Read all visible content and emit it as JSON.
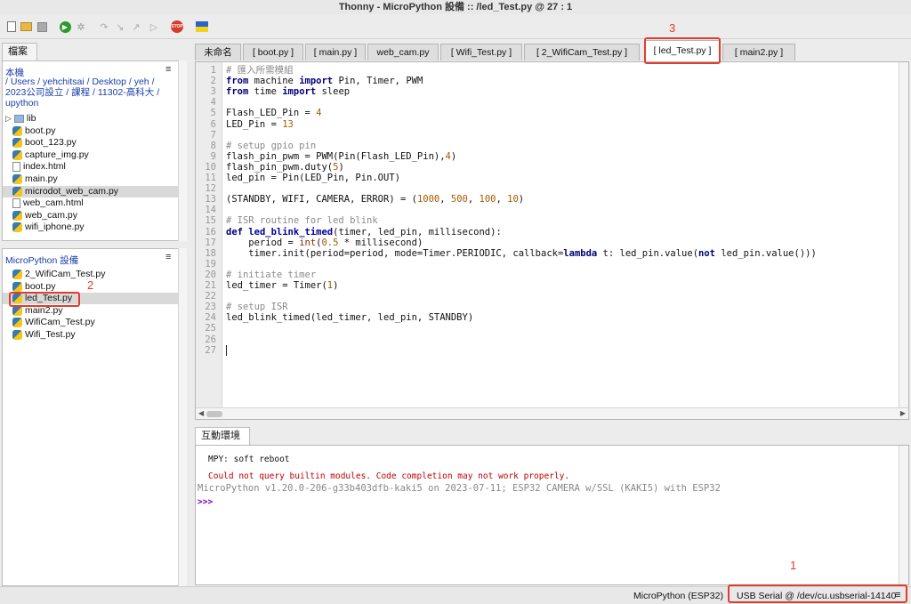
{
  "window": {
    "title": "Thonny  -  MicroPython 設備 :: /led_Test.py  @  27 : 1"
  },
  "toolbar": {
    "items": [
      "new-file-icon",
      "open-file-icon",
      "save-icon",
      "run-icon",
      "debug-icon",
      "step-over-icon",
      "step-into-icon",
      "step-out-icon",
      "resume-icon",
      "stop-icon",
      "flag-icon"
    ],
    "stop_label": "STOP"
  },
  "files_panel": {
    "tab": "檔案",
    "local": {
      "heading": "本機",
      "path_lines": [
        "/ Users / yehchitsai / Desktop / yeh /",
        "2023公司設立 / 課程 / 11302-高科大 /",
        "upython"
      ],
      "items": [
        {
          "name": "lib",
          "type": "folder"
        },
        {
          "name": "boot.py",
          "type": "py"
        },
        {
          "name": "boot_123.py",
          "type": "py"
        },
        {
          "name": "capture_img.py",
          "type": "py"
        },
        {
          "name": "index.html",
          "type": "file"
        },
        {
          "name": "main.py",
          "type": "py"
        },
        {
          "name": "microdot_web_cam.py",
          "type": "py",
          "selected": true
        },
        {
          "name": "web_cam.html",
          "type": "file"
        },
        {
          "name": "web_cam.py",
          "type": "py"
        },
        {
          "name": "wifi_iphone.py",
          "type": "py"
        }
      ]
    },
    "device": {
      "heading": "MicroPython 設備",
      "items": [
        {
          "name": "2_WifiCam_Test.py",
          "type": "py"
        },
        {
          "name": "boot.py",
          "type": "py"
        },
        {
          "name": "led_Test.py",
          "type": "py",
          "selected": true
        },
        {
          "name": "main2.py",
          "type": "py"
        },
        {
          "name": "WifiCam_Test.py",
          "type": "py"
        },
        {
          "name": "Wifi_Test.py",
          "type": "py"
        }
      ]
    }
  },
  "editor": {
    "tabs": [
      "未命名",
      "[ boot.py ]",
      "[ main.py ]",
      "web_cam.py",
      "[ Wifi_Test.py ]",
      "[ 2_WifiCam_Test.py ]",
      "[ led_Test.py ]",
      "[ main2.py ]"
    ],
    "active_tab": 6,
    "lines": [
      "# 匯入所需模組",
      "from machine import Pin, Timer, PWM",
      "from time import sleep",
      "",
      "Flash_LED_Pin = 4",
      "LED_Pin = 13",
      "",
      "# setup gpio pin",
      "flash_pin_pwm = PWM(Pin(Flash_LED_Pin),4)",
      "flash_pin_pwm.duty(5)",
      "led_pin = Pin(LED_Pin, Pin.OUT)",
      "",
      "(STANDBY, WIFI, CAMERA, ERROR) = (1000, 500, 100, 10)",
      "",
      "# ISR routine for led blink",
      "def led_blink_timed(timer, led_pin, millisecond):",
      "    period = int(0.5 * millisecond)",
      "    timer.init(period=period, mode=Timer.PERIODIC, callback=lambda t: led_pin.value(not led_pin.value()))",
      "",
      "# initiate timer",
      "led_timer = Timer(1)",
      "",
      "# setup ISR",
      "led_blink_timed(led_timer, led_pin, STANDBY)",
      "",
      "",
      ""
    ]
  },
  "shell": {
    "tab": "互動環境",
    "lines": [
      {
        "text": "MPY: soft reboot",
        "style": "normal"
      },
      {
        "text": "Could not query builtin modules. Code completion may not work properly.",
        "style": "error"
      },
      {
        "text": "MicroPython v1.20.0-206-g33b403dfb-kaki5 on 2023-07-11; ESP32 CAMERA w/SSL (KAKI5) with ESP32",
        "style": "info"
      },
      {
        "text": ">>>",
        "style": "prompt"
      }
    ]
  },
  "status": {
    "interpreter": "MicroPython (ESP32)",
    "port": "USB Serial @ /dev/cu.usbserial-14140"
  },
  "annotations": [
    "1",
    "2",
    "3"
  ],
  "colors": {
    "annotation": "#e23c2c",
    "keyword": "#00007a",
    "comment": "#8a8a8a",
    "number": "#a85a00",
    "error": "#c00000",
    "prompt": "#7a00c0"
  }
}
